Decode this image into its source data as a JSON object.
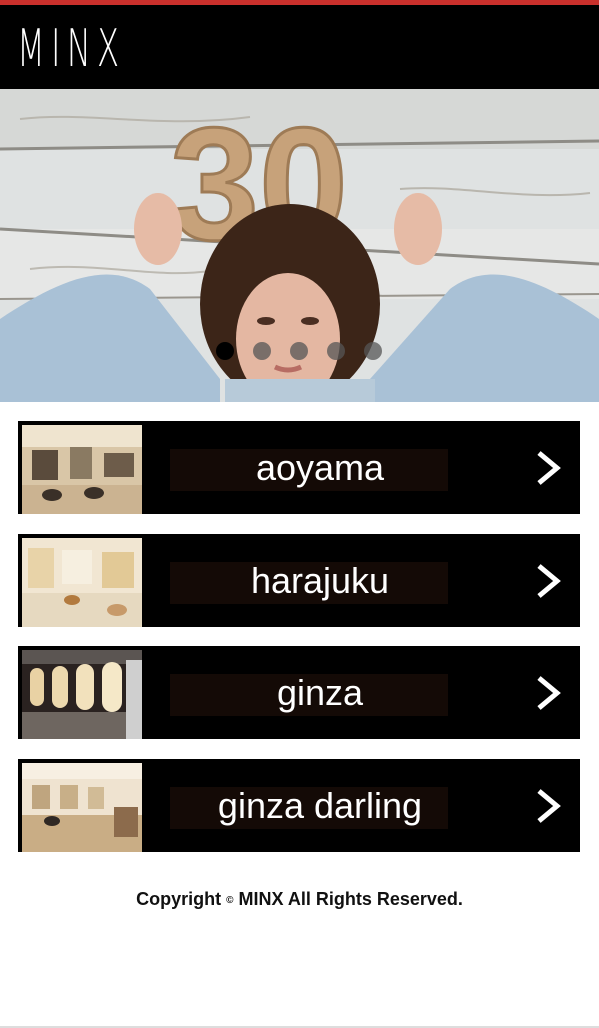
{
  "brand": {
    "name": "MINX"
  },
  "hero": {
    "image_alt": "woman holding number cutout 30 against white wooden wall",
    "overlay_number": "30",
    "slides": 5,
    "active_slide": 1
  },
  "stores": [
    {
      "name": "aoyama"
    },
    {
      "name": "harajuku"
    },
    {
      "name": "ginza"
    },
    {
      "name": "ginza darling"
    }
  ],
  "footer": {
    "copyright": "Copyright",
    "symbol": "©",
    "owner": "MINX All Rights Reserved."
  },
  "colors": {
    "accent": "#c9302c",
    "header_bg": "#000000",
    "button_bg": "#000000"
  }
}
